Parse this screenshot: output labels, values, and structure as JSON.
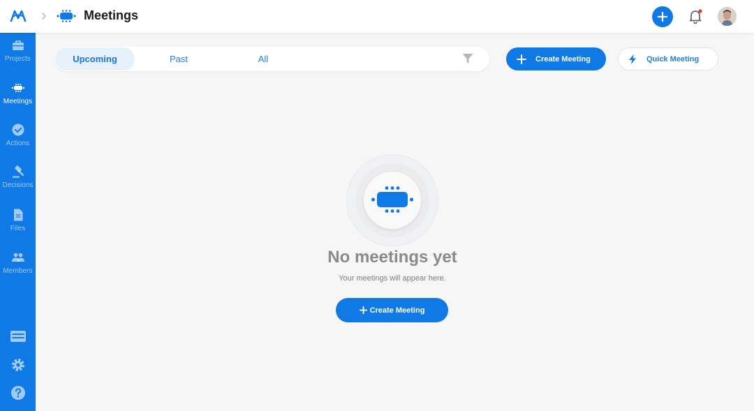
{
  "header": {
    "title": "Meetings",
    "icons": [
      "app-logo",
      "chevron-right-icon",
      "meeting-table-icon",
      "plus-icon",
      "bell-icon",
      "avatar"
    ],
    "notification_dot_color": "#e53935"
  },
  "sidebar": {
    "items": [
      {
        "label": "Projects",
        "icon": "briefcase-icon"
      },
      {
        "label": "Meetings",
        "icon": "meeting-table-icon",
        "active": true
      },
      {
        "label": "Actions",
        "icon": "check-circle-icon"
      },
      {
        "label": "Decisions",
        "icon": "gavel-icon"
      },
      {
        "label": "Files",
        "icon": "file-icon"
      },
      {
        "label": "Members",
        "icon": "people-icon"
      }
    ],
    "bottom_icons": [
      "keyboard-icon",
      "settings-icon",
      "help-icon"
    ]
  },
  "filters": {
    "tabs": [
      "Upcoming",
      "Past",
      "All"
    ],
    "selected": "Upcoming",
    "filter_icon": "funnel-icon"
  },
  "actions": {
    "create_label": "Create Meeting",
    "quick_label": "Quick Meeting"
  },
  "empty_state": {
    "title": "No meetings yet",
    "subtitle": "Your meetings will appear here.",
    "button_label": "Create Meeting"
  },
  "colors": {
    "primary": "#0f7ae5",
    "background": "#f6f6f7",
    "tab_active_bg": "#e6f1fc"
  }
}
